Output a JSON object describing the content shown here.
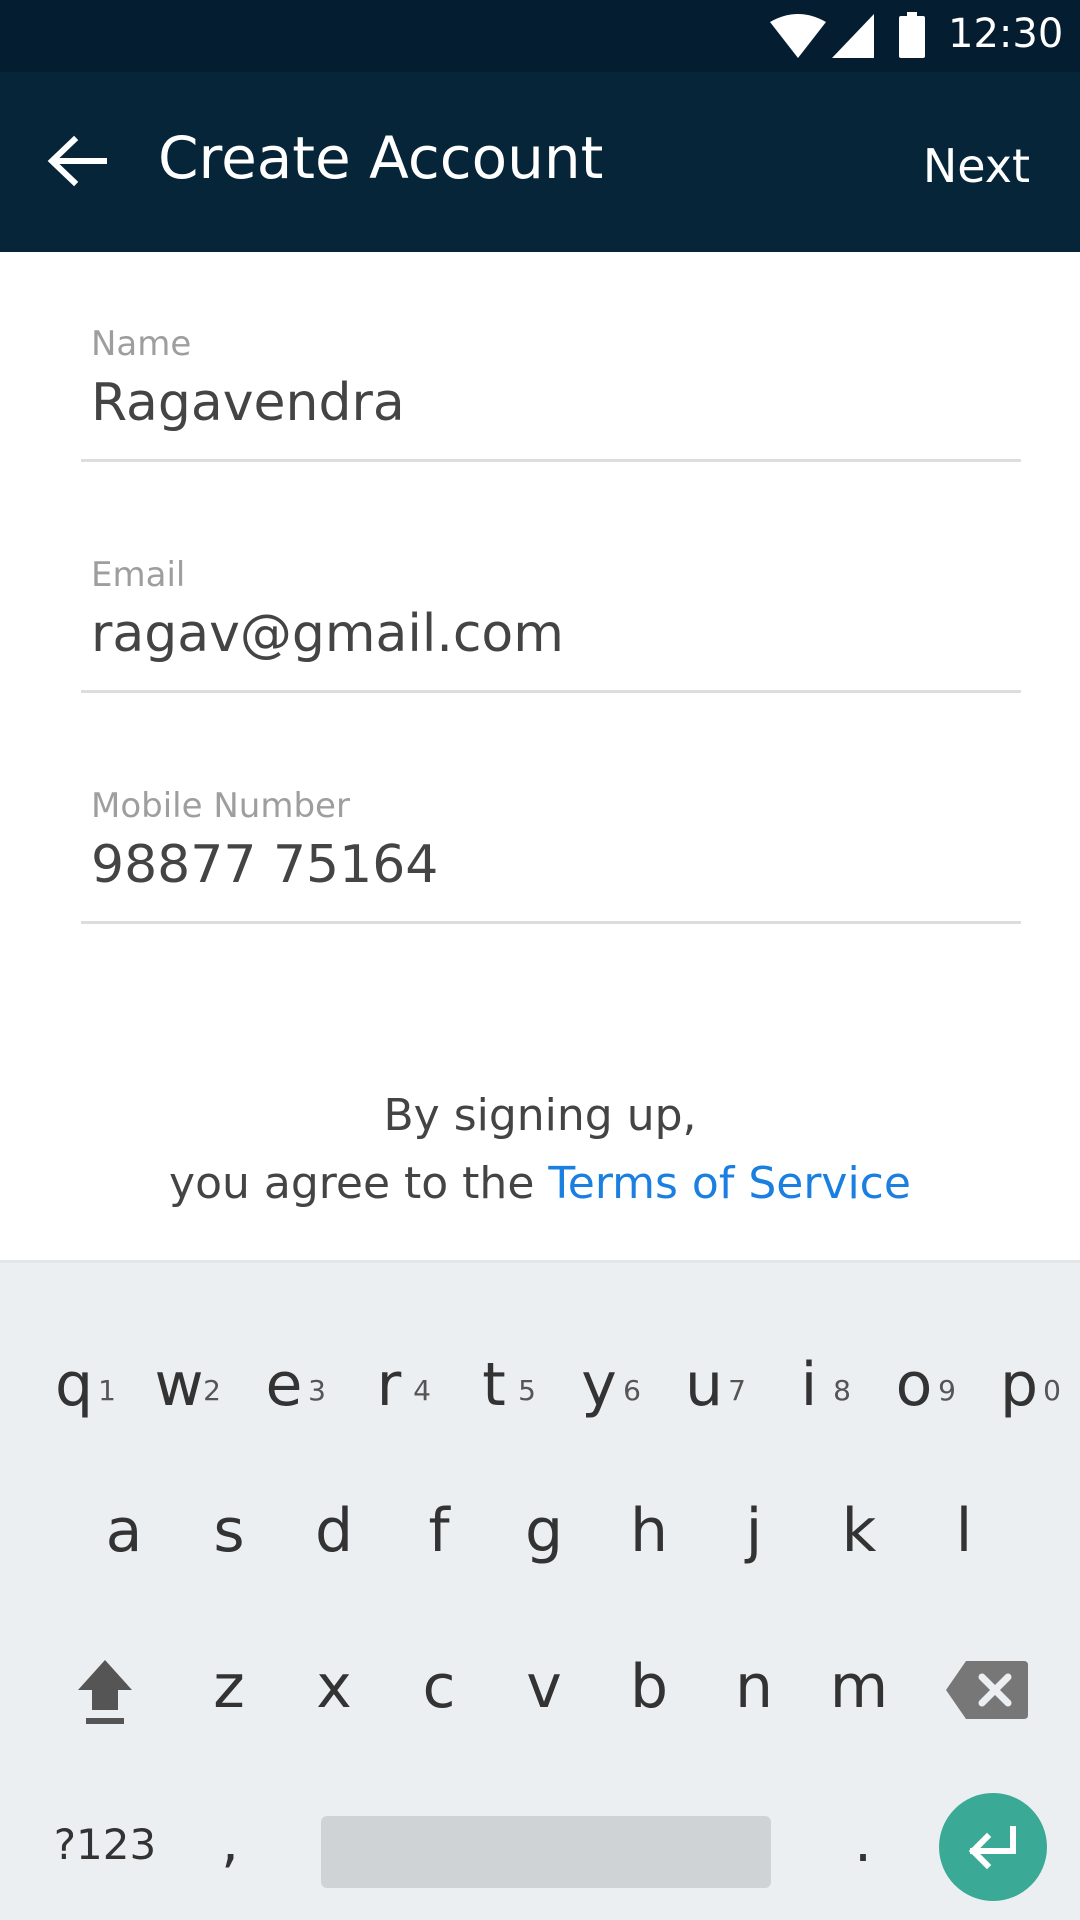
{
  "status_bar": {
    "time": "12:30",
    "icons": [
      "wifi-icon",
      "cellular-signal-icon",
      "battery-icon"
    ]
  },
  "app_bar": {
    "title": "Create Account",
    "next_label": "Next",
    "back_icon": "arrow-left-icon",
    "background": "#072539"
  },
  "form": {
    "name": {
      "label": "Name",
      "value": "Ragavendra"
    },
    "email": {
      "label": "Email",
      "value": "ragav@gmail.com"
    },
    "mobile": {
      "label": "Mobile Number",
      "value": "98877 75164"
    }
  },
  "terms": {
    "line1": "By signing up,",
    "line2_prefix": "you agree to the ",
    "link": "Terms of Service",
    "link_color": "#1a7fe0"
  },
  "keyboard": {
    "row1": [
      {
        "key": "q",
        "hint": "1"
      },
      {
        "key": "w",
        "hint": "2"
      },
      {
        "key": "e",
        "hint": "3"
      },
      {
        "key": "r",
        "hint": "4"
      },
      {
        "key": "t",
        "hint": "5"
      },
      {
        "key": "y",
        "hint": "6"
      },
      {
        "key": "u",
        "hint": "7"
      },
      {
        "key": "i",
        "hint": "8"
      },
      {
        "key": "o",
        "hint": "9"
      },
      {
        "key": "p",
        "hint": "0"
      }
    ],
    "row2": [
      "a",
      "s",
      "d",
      "f",
      "g",
      "h",
      "j",
      "k",
      "l"
    ],
    "row3": [
      "z",
      "x",
      "c",
      "v",
      "b",
      "n",
      "m"
    ],
    "symbols_label": "?123",
    "comma": ",",
    "period": ".",
    "enter_color": "#3aa996"
  }
}
